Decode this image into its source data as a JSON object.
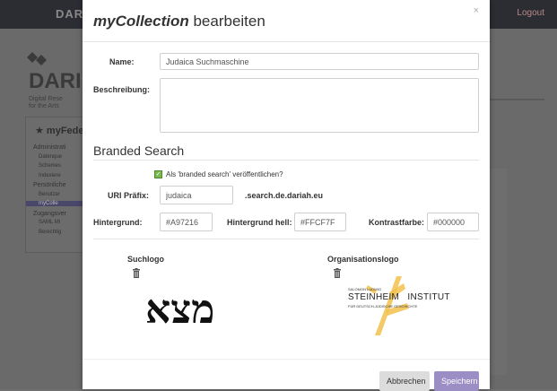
{
  "app": {
    "brand": "DARIAH",
    "login_label": "Logout",
    "logo_word": "DARI",
    "logo_sub": [
      "Digital Rese",
      "for the Arts"
    ],
    "sidebar": {
      "title": "myFede",
      "rows": [
        {
          "label": "Administrati",
          "sub": false,
          "active": false
        },
        {
          "label": "Datenque",
          "sub": true,
          "active": false
        },
        {
          "label": "Schemes",
          "sub": true,
          "active": false
        },
        {
          "label": "Indexiere",
          "sub": true,
          "active": false
        },
        {
          "label": "Persönliche",
          "sub": false,
          "active": false
        },
        {
          "label": "Benutzer",
          "sub": true,
          "active": false
        },
        {
          "label": "myColle",
          "sub": true,
          "active": true
        },
        {
          "label": "Zugangsver",
          "sub": false,
          "active": false
        },
        {
          "label": "SAML Mi",
          "sub": true,
          "active": false
        },
        {
          "label": "Berechtig",
          "sub": true,
          "active": false
        }
      ]
    }
  },
  "modal": {
    "title_em": "myCollection",
    "title_rest": " bearbeiten",
    "close_icon": "×",
    "name_label": "Name:",
    "name_value": "Judaica Suchmaschine",
    "description_label": "Beschreibung:",
    "description_value": "",
    "branded_title": "Branded Search",
    "publish_label": "Als 'branded search' veröffentlichen?",
    "publish_checked": true,
    "uri_label": "URI Präfix:",
    "uri_value": "judaica",
    "uri_suffix": ".search.de.dariah.eu",
    "bg_label": "Hintergrund:",
    "bg_value": "#A97216",
    "bg_light_label": "Hintergrund hell:",
    "bg_light_value": "#FFCF7F",
    "contrast_label": "Kontrastfarbe:",
    "contrast_value": "#000000",
    "search_logo_label": "Suchlogo",
    "org_logo_label": "Organisationslogo",
    "search_logo_text": "מצא",
    "org_logo": {
      "line1": "SALOMON LUDWIG",
      "line2": "STEINHEIM   INSTITUT",
      "line3": "FÜR DEUTSCH-JÜDISCHE GESCHICHTE"
    },
    "cancel_label": "Abbrechen",
    "save_label": "Speichern"
  },
  "colors": {
    "accent": "#9a8ec4",
    "checkbox": "#7cb84e",
    "org_logo_yellow": "#f2c14e"
  }
}
